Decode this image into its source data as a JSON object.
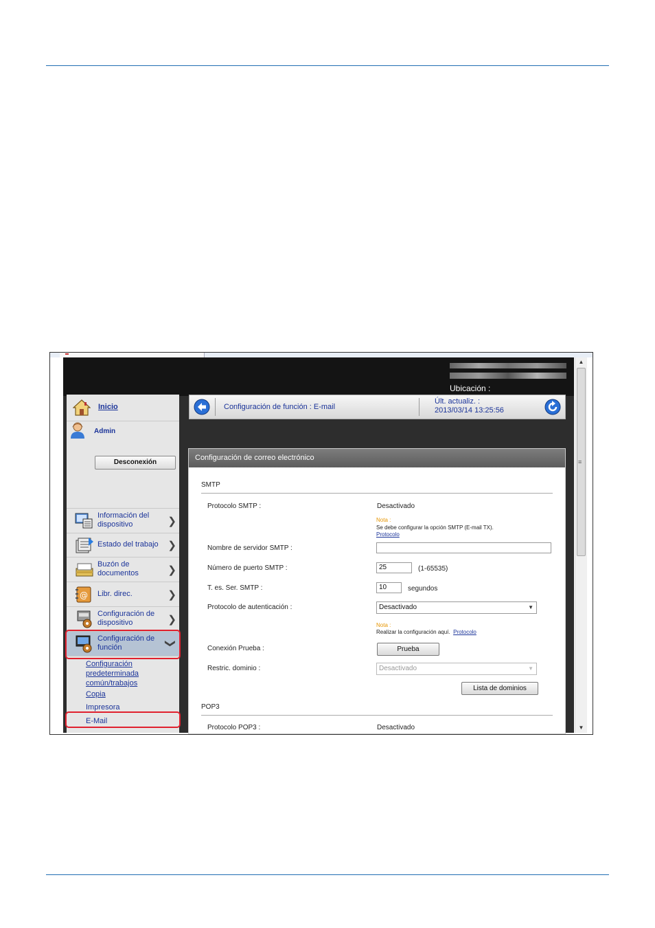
{
  "window": {
    "location_label": "Ubicación :"
  },
  "sidebar": {
    "home_link": "Inicio",
    "user": "Admin",
    "logout_button": "Desconexión",
    "items": [
      {
        "label": "Información del dispositivo",
        "icon": "device-info-icon"
      },
      {
        "label": "Estado del trabajo",
        "icon": "job-status-icon"
      },
      {
        "label": "Buzón de documentos",
        "icon": "document-box-icon"
      },
      {
        "label": "Libr. direc.",
        "icon": "address-book-icon"
      },
      {
        "label": "Configuración de dispositivo",
        "icon": "device-settings-icon"
      },
      {
        "label": "Configuración de función",
        "icon": "function-settings-icon"
      }
    ],
    "subitems": {
      "common": "Configuración predeterminada común/trabajos",
      "copy": "Copia",
      "printer": "Impresora",
      "email": "E-Mail"
    }
  },
  "header": {
    "title": "Configuración de función : E-mail",
    "last_update_label": "Últ. actualiz. :",
    "last_update_value": "2013/03/14 13:25:56"
  },
  "panel": {
    "title": "Configuración de correo electrónico",
    "smtp_section": "SMTP",
    "smtp_protocol_label": "Protocolo SMTP :",
    "smtp_protocol_value": "Desactivado",
    "note1_title": "Nota :",
    "note1_text": "Se debe configurar la opción SMTP (E-mail TX).",
    "note1_link": "Protocolo",
    "smtp_server_label": "Nombre de servidor SMTP :",
    "smtp_server_value": "",
    "smtp_port_label": "Número de puerto SMTP :",
    "smtp_port_value": "25",
    "smtp_port_range": "(1-65535)",
    "smtp_timeout_label": "T. es. Ser. SMTP :",
    "smtp_timeout_value": "10",
    "smtp_timeout_unit": "segundos",
    "auth_protocol_label": "Protocolo de autenticación :",
    "auth_protocol_value": "Desactivado",
    "note2_title": "Nota :",
    "note2_text": "Realizar la configuración aquí.",
    "note2_link": "Protocolo",
    "test_label": "Conexión Prueba :",
    "test_button": "Prueba",
    "domain_label": "Restric. dominio :",
    "domain_value": "Desactivado",
    "domain_list_button": "Lista de dominios",
    "pop3_section": "POP3",
    "pop3_protocol_label": "Protocolo POP3 :",
    "pop3_protocol_value": "Desactivado"
  },
  "colors": {
    "link": "#1a3399",
    "highlight": "#e0202e",
    "note": "#e69500",
    "rule": "#1f6db3"
  }
}
